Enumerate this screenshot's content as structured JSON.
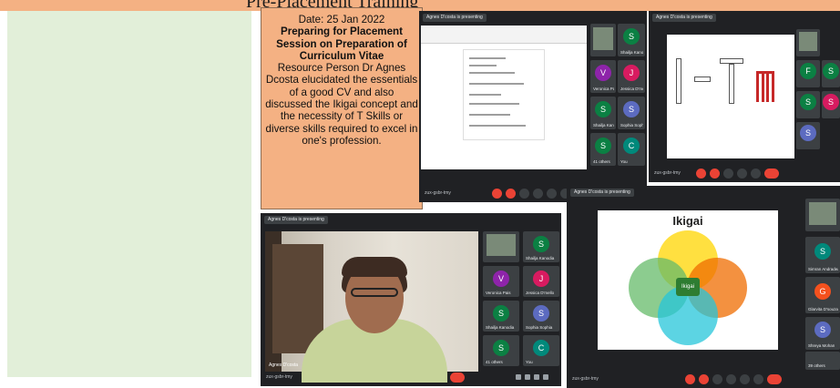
{
  "banner": {
    "text": "Pre-Placement Training"
  },
  "info_box": {
    "date": "Date: 25 Jan 2022",
    "title": "Preparing for Placement Session on Preparation of Curriculum Vitae",
    "body": "Resource Person Dr Agnes Dcosta elucidated the essentials of a good CV and also discussed the Ikigai concept and the necessity of T Skills  or diverse skills required to excel in one's profession."
  },
  "meet": {
    "presenting": "Agnes D'costa is presenting",
    "meeting_code": "zux-gsbr-tmy",
    "others_count": "41 others",
    "others_count_2": "39 others",
    "you_label": "You",
    "ikigai_title": "Ikigai",
    "ikigai_center": "Ikigai",
    "cam_name": "Agnes D'costa",
    "participants_top": [
      {
        "initial": "S",
        "name": "Shailja Kanodia",
        "color": "#0b8043"
      },
      {
        "initial": "V",
        "name": "Veronica Pais",
        "color": "#8e24aa"
      },
      {
        "initial": "J",
        "name": "Jessica D'mello",
        "color": "#d81b60"
      },
      {
        "initial": "S",
        "name": "Shailja Kanodia",
        "color": "#0b8043"
      },
      {
        "initial": "S",
        "name": "Sophia Sophia",
        "color": "#5c6bc0"
      },
      {
        "initial": "S",
        "name": "Sarika Aradhye",
        "color": "#0b8043"
      },
      {
        "initial": "P",
        "name": "Pallavi Salesai",
        "color": "#d81b60"
      }
    ],
    "participants_right": [
      {
        "initial": "S",
        "name": "Simran Andradea",
        "color": "#00897b"
      },
      {
        "initial": "G",
        "name": "Glarvita D'souza",
        "color": "#f4511e"
      },
      {
        "initial": "S",
        "name": "Shreya Mohan",
        "color": "#5c6bc0"
      }
    ],
    "second_window_tiles": [
      {
        "initial": "F",
        "color": "#0b8043"
      },
      {
        "initial": "S",
        "color": "#0b8043"
      },
      {
        "initial": "S",
        "color": "#5c6bc0"
      },
      {
        "initial": "S",
        "color": "#0b8043"
      },
      {
        "initial": "S",
        "color": "#d81b60"
      },
      {
        "initial": "S",
        "color": "#0b8043"
      }
    ]
  },
  "icons": {
    "mic": "microphone-icon",
    "cam": "camera-icon",
    "end": "end-call-icon"
  },
  "colors": {
    "info_bg": "#f4b183",
    "left_panel": "#e2efd9",
    "meet_bg": "#202124"
  }
}
